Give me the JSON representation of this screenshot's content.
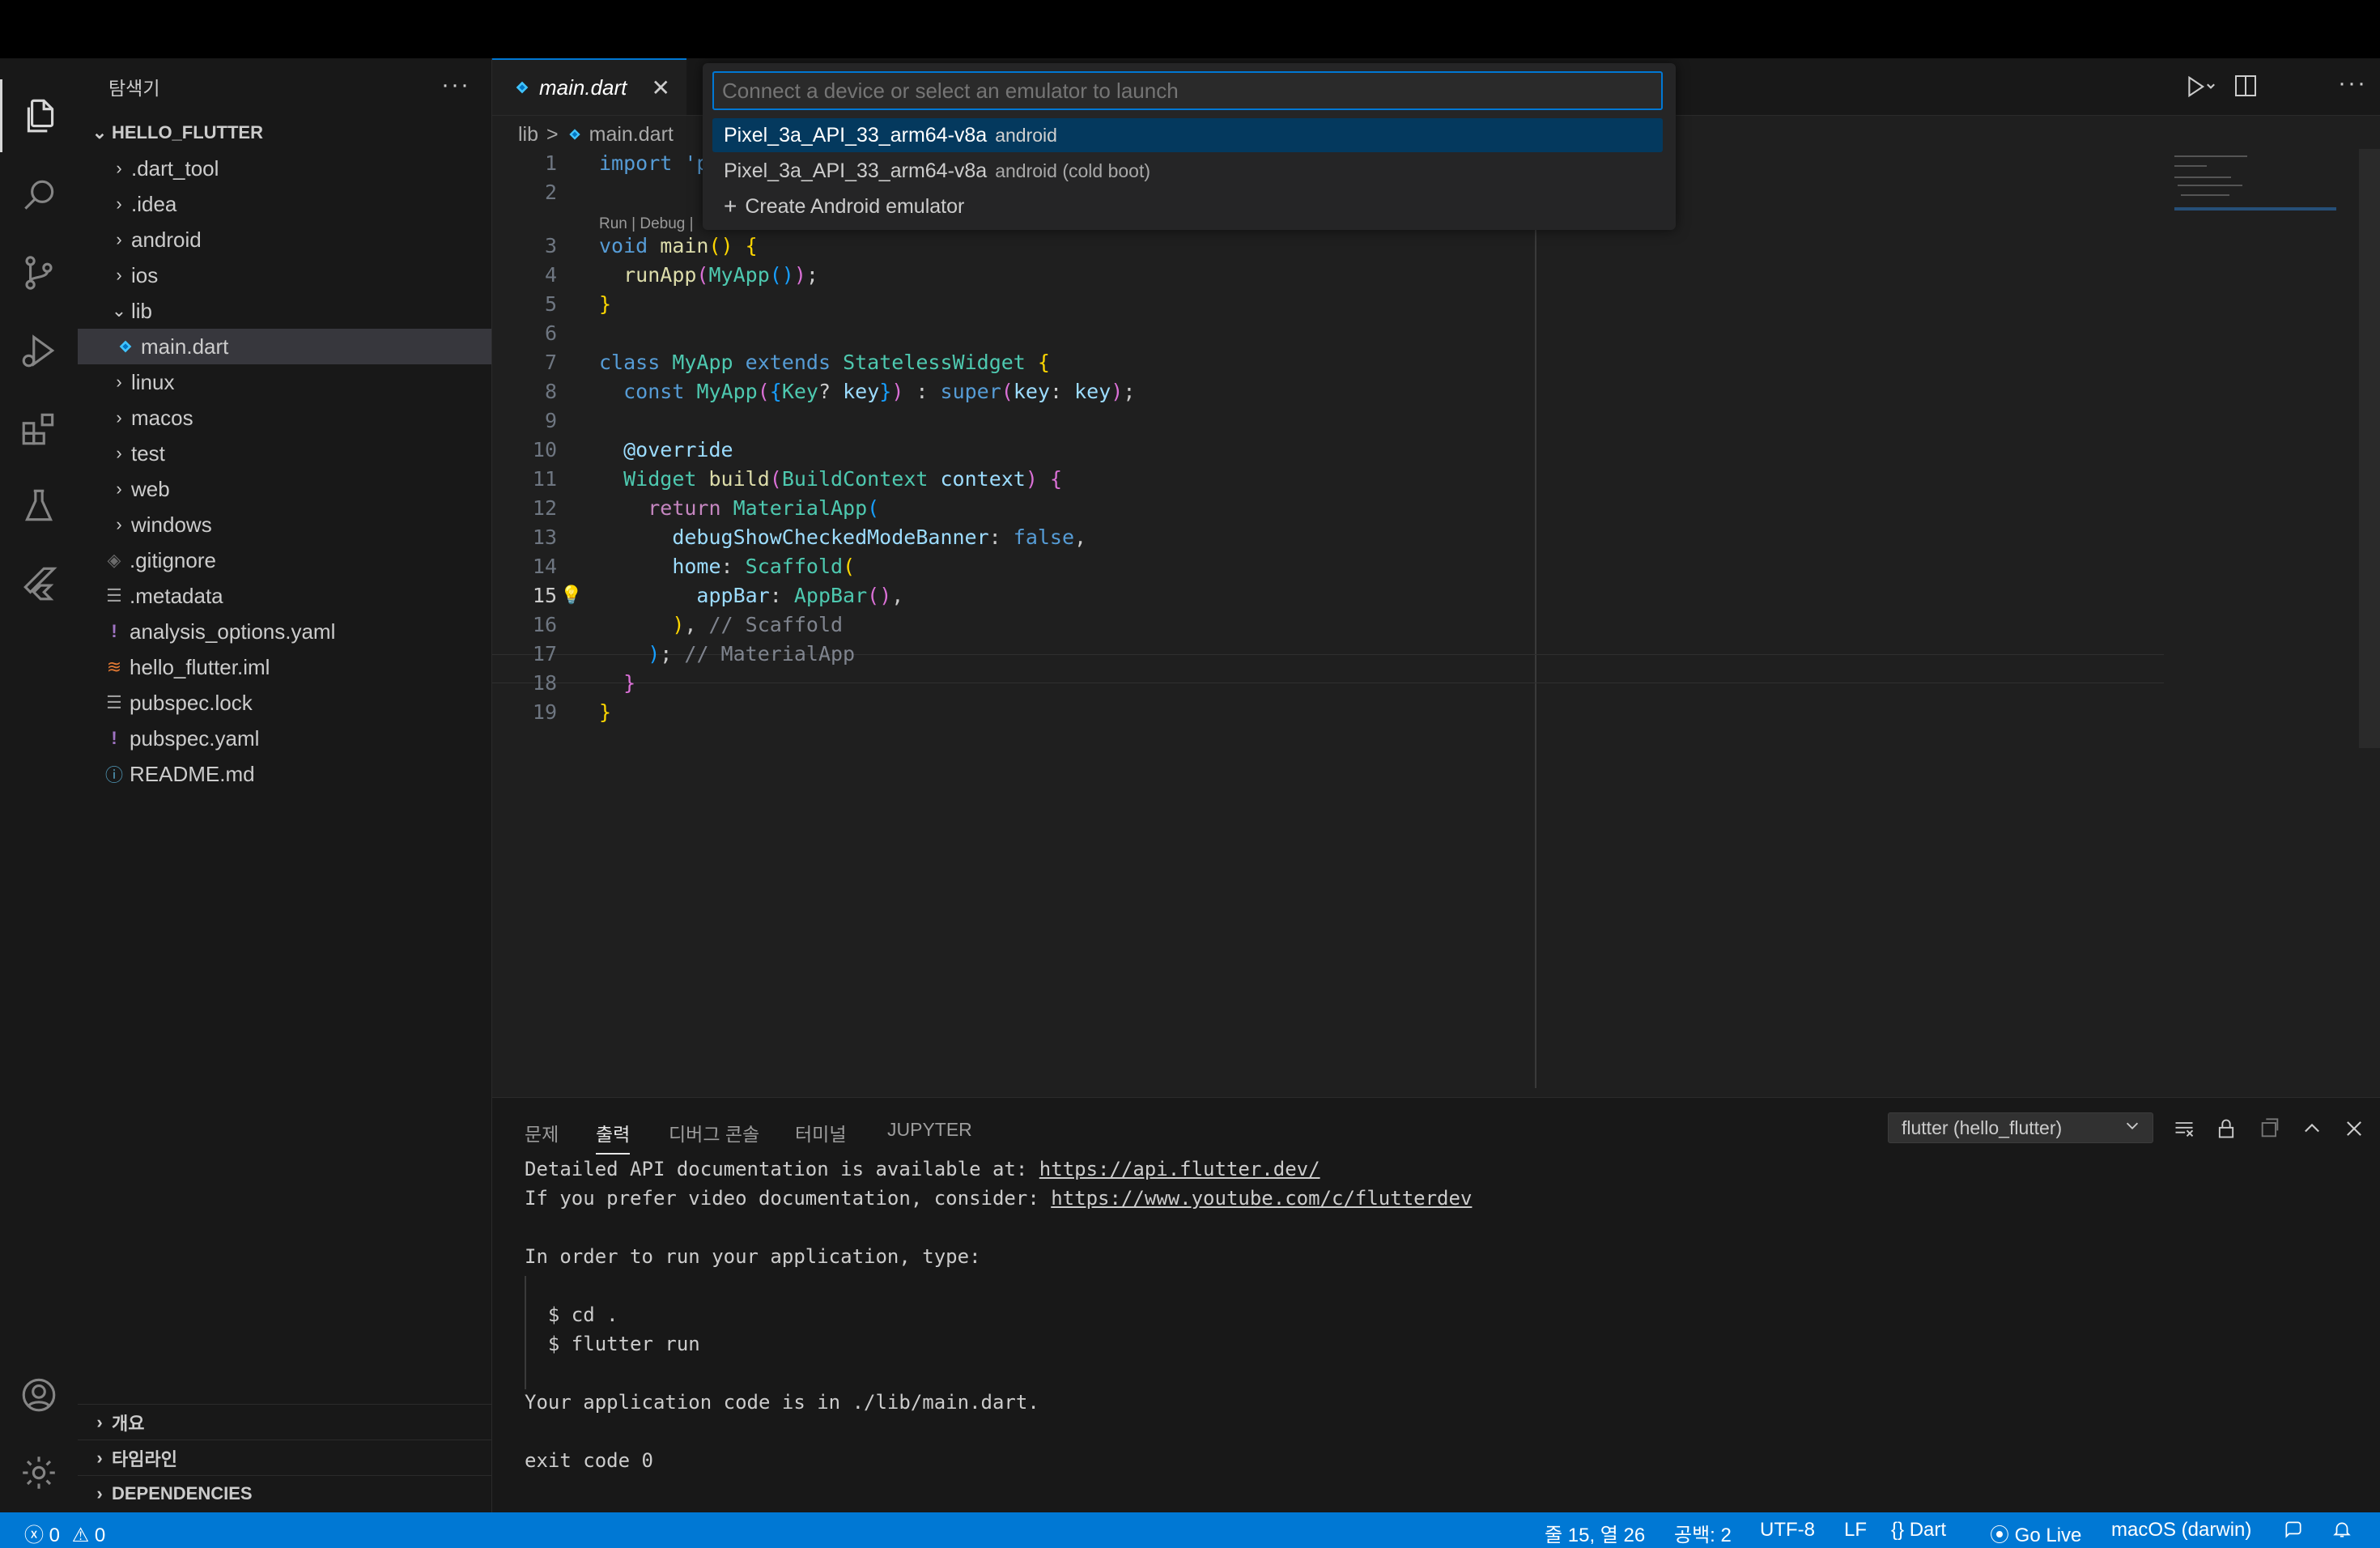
{
  "explorer": {
    "title": "탐색기",
    "more": "···",
    "root": "HELLO_FLUTTER",
    "items": [
      {
        "label": ".dart_tool",
        "kind": "folder"
      },
      {
        "label": ".idea",
        "kind": "folder"
      },
      {
        "label": "android",
        "kind": "folder"
      },
      {
        "label": "ios",
        "kind": "folder"
      },
      {
        "label": "lib",
        "kind": "folder-open"
      },
      {
        "label": "main.dart",
        "kind": "dart-file"
      },
      {
        "label": "linux",
        "kind": "folder"
      },
      {
        "label": "macos",
        "kind": "folder"
      },
      {
        "label": "test",
        "kind": "folder"
      },
      {
        "label": "web",
        "kind": "folder"
      },
      {
        "label": "windows",
        "kind": "folder"
      },
      {
        "label": ".gitignore",
        "kind": "git-file"
      },
      {
        "label": ".metadata",
        "kind": "text-file"
      },
      {
        "label": "analysis_options.yaml",
        "kind": "yaml-file"
      },
      {
        "label": "hello_flutter.iml",
        "kind": "rss-file"
      },
      {
        "label": "pubspec.lock",
        "kind": "text-file"
      },
      {
        "label": "pubspec.yaml",
        "kind": "yaml-file"
      },
      {
        "label": "README.md",
        "kind": "info-file"
      }
    ],
    "sections": [
      "개요",
      "타임라인",
      "DEPENDENCIES"
    ]
  },
  "tab": {
    "label": "main.dart",
    "close": "✕"
  },
  "breadcrumb": {
    "folder": "lib",
    "sep": ">",
    "file": "main.dart"
  },
  "codelens": "Run | Debug |",
  "code": {
    "line1": "import 'p",
    "nums": [
      "1",
      "2",
      "3",
      "4",
      "5",
      "6",
      "7",
      "8",
      "9",
      "10",
      "11",
      "12",
      "13",
      "14",
      "15",
      "16",
      "17",
      "18",
      "19"
    ]
  },
  "quickpick": {
    "placeholder": "Connect a device or select an emulator to launch",
    "items": [
      {
        "label": "Pixel_3a_API_33_arm64-v8a",
        "desc": "android"
      },
      {
        "label": "Pixel_3a_API_33_arm64-v8a",
        "desc": "android (cold boot)"
      },
      {
        "label": "Create Android emulator",
        "desc": ""
      }
    ],
    "plus": "+"
  },
  "panel": {
    "tabs": [
      "문제",
      "출력",
      "디버그 콘솔",
      "터미널",
      "JUPYTER"
    ],
    "active_tab": "출력",
    "channel": "flutter (hello_flutter)",
    "output": {
      "l1_text": "Detailed API documentation is available at: ",
      "l1_link": "https://api.flutter.dev/",
      "l2_text": "If you prefer video documentation, consider: ",
      "l2_link": "https://www.youtube.com/c/flutterdev",
      "l3": "In order to run your application, type:",
      "l4": "  $ cd .",
      "l5": "  $ flutter run",
      "l6": "Your application code is in ./lib/main.dart.",
      "l7": "exit code 0"
    }
  },
  "status": {
    "errors": "0",
    "warnings": "0",
    "position": "줄 15, 열 26",
    "spaces": "공백: 2",
    "encoding": "UTF-8",
    "eol": "LF",
    "language": "Dart",
    "golive": "Go Live",
    "device": "macOS (darwin)"
  },
  "colors": {
    "accent": "#0078d4",
    "statusbar": "#0078d4",
    "editor_bg": "#1f1f1f",
    "sidebar_bg": "#181818",
    "quickpick_active": "#04395e"
  }
}
